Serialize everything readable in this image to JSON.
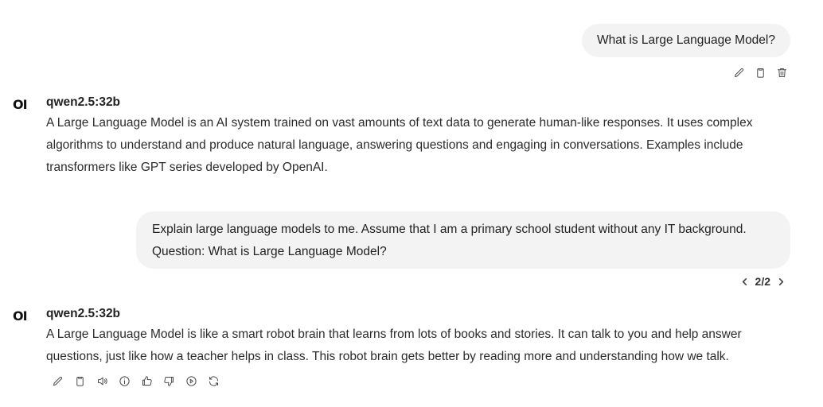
{
  "messages": {
    "user_1": {
      "text": "What is Large Language Model?"
    },
    "assistant_1": {
      "avatar": "OI",
      "model": "qwen2.5:32b",
      "lines": [
        "A Large Language Model is an AI system trained on vast amounts of text data to generate human-like responses. It uses complex",
        "algorithms to understand and produce natural language, answering questions and engaging in conversations. Examples include",
        "transformers like GPT series developed by OpenAI."
      ]
    },
    "user_2": {
      "lines": [
        "Explain large language models to me. Assume that I am a primary school student without any IT background.",
        "Question: What is Large Language Model?"
      ],
      "pager": "2/2"
    },
    "assistant_2": {
      "avatar": "OI",
      "model": "qwen2.5:32b",
      "lines": [
        "A Large Language Model is like a smart robot brain that learns from lots of books and stories. It can talk to you and help answer",
        "questions, just like how a teacher helps in class. This robot brain gets better by reading more and understanding how we talk."
      ]
    }
  },
  "icons": {
    "user_actions": [
      "pencil-icon",
      "clipboard-icon",
      "trash-icon"
    ],
    "assistant_actions": [
      "pencil-icon",
      "clipboard-icon",
      "speaker-icon",
      "info-icon",
      "thumbs-up-icon",
      "thumbs-down-icon",
      "play-circle-icon",
      "refresh-icon"
    ],
    "pager": [
      "chevron-left-icon",
      "chevron-right-icon"
    ]
  }
}
